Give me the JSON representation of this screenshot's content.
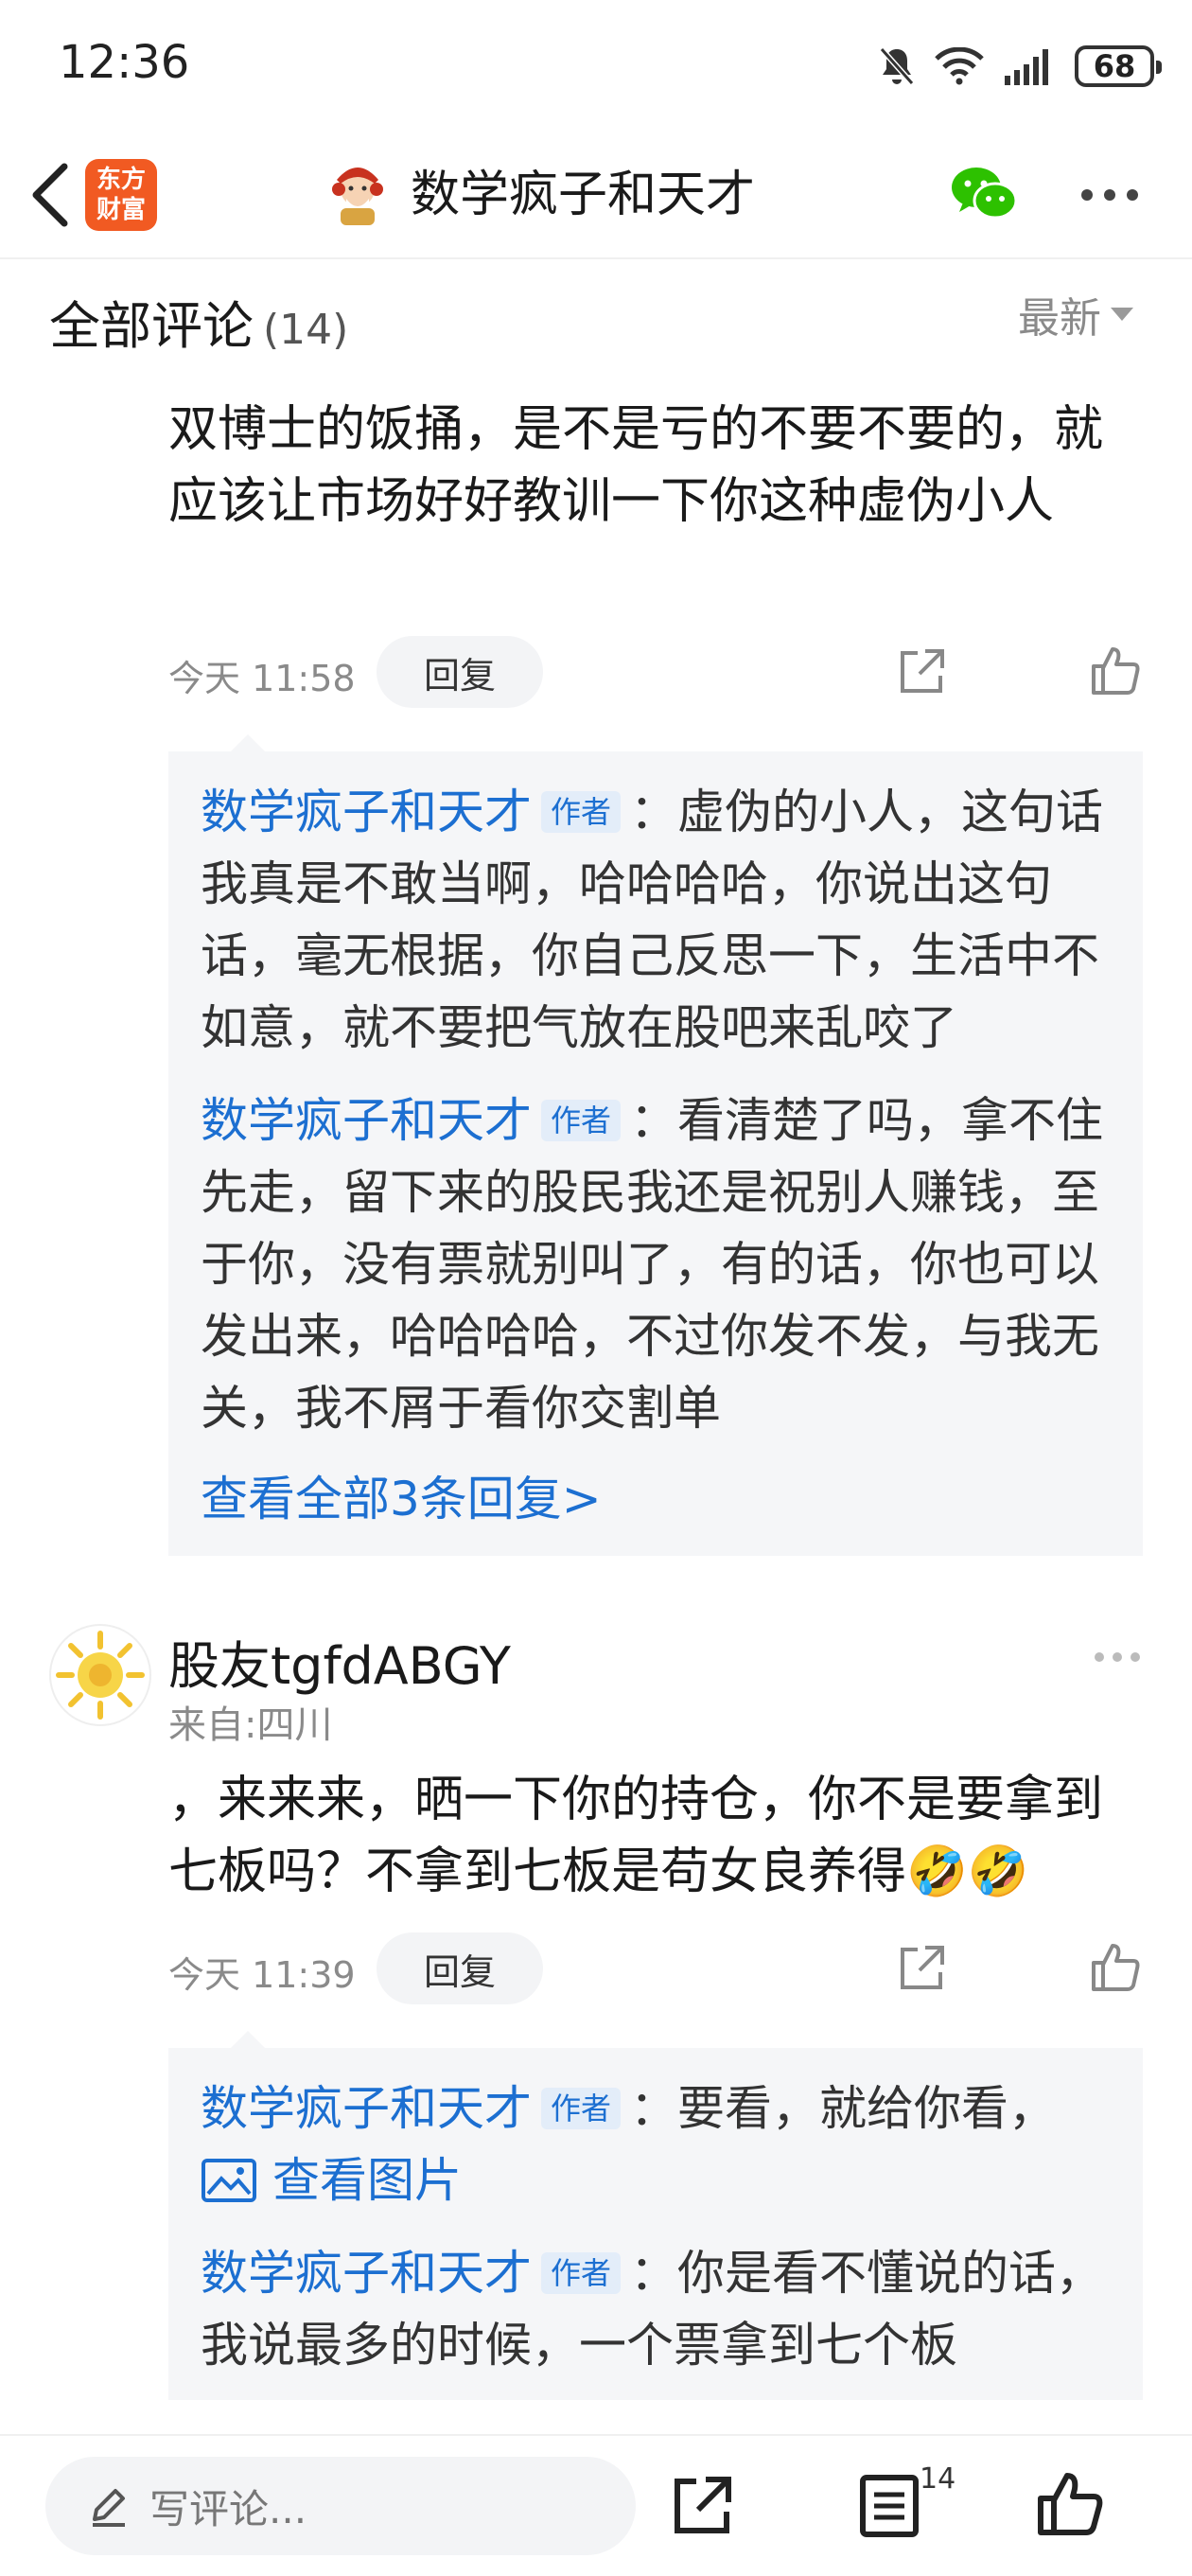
{
  "status_bar": {
    "time": "12:36",
    "battery": "68"
  },
  "header": {
    "brand_line1": "东方",
    "brand_line2": "财富",
    "title": "数学疯子和天才"
  },
  "comments_section": {
    "title": "全部评论",
    "count": "(14)",
    "sort_label": "最新"
  },
  "comments": [
    {
      "text": "双博士的饭捅，是不是亏的不要不要的，就应该让市场好好教训一下你这种虚伪小人",
      "time": "今天 11:58",
      "reply_label": "回复",
      "replies": [
        {
          "name": "数学疯子和天才",
          "tag": "作者",
          "text": "：虚伪的小人，这句话我真是不敢当啊，哈哈哈哈，你说出这句话，毫无根据，你自己反思一下，生活中不如意，就不要把气放在股吧来乱咬了"
        },
        {
          "name": "数学疯子和天才",
          "tag": "作者",
          "text": "：看清楚了吗，拿不住先走，留下来的股民我还是祝别人赚钱，至于你，没有票就别叫了，有的话，你也可以发出来，哈哈哈哈，不过你发不发，与我无关，我不屑于看你交割单"
        }
      ],
      "view_all": "查看全部3条回复>"
    },
    {
      "user": "股友tgfdABGY",
      "from": "来自:四川",
      "text": "，来来来，晒一下你的持仓，你不是要拿到七板吗？不拿到七板是苟女良养得",
      "emoji": "🤣🤣",
      "time": "今天 11:39",
      "reply_label": "回复",
      "replies": [
        {
          "name": "数学疯子和天才",
          "tag": "作者",
          "text": "：要看，就给你看，",
          "image_link": "查看图片"
        },
        {
          "name": "数学疯子和天才",
          "tag": "作者",
          "text": "：你是看不懂说的话，我说最多的时候，一个票拿到七个板"
        }
      ]
    }
  ],
  "bottom_bar": {
    "placeholder": "写评论...",
    "comment_count": "14"
  }
}
